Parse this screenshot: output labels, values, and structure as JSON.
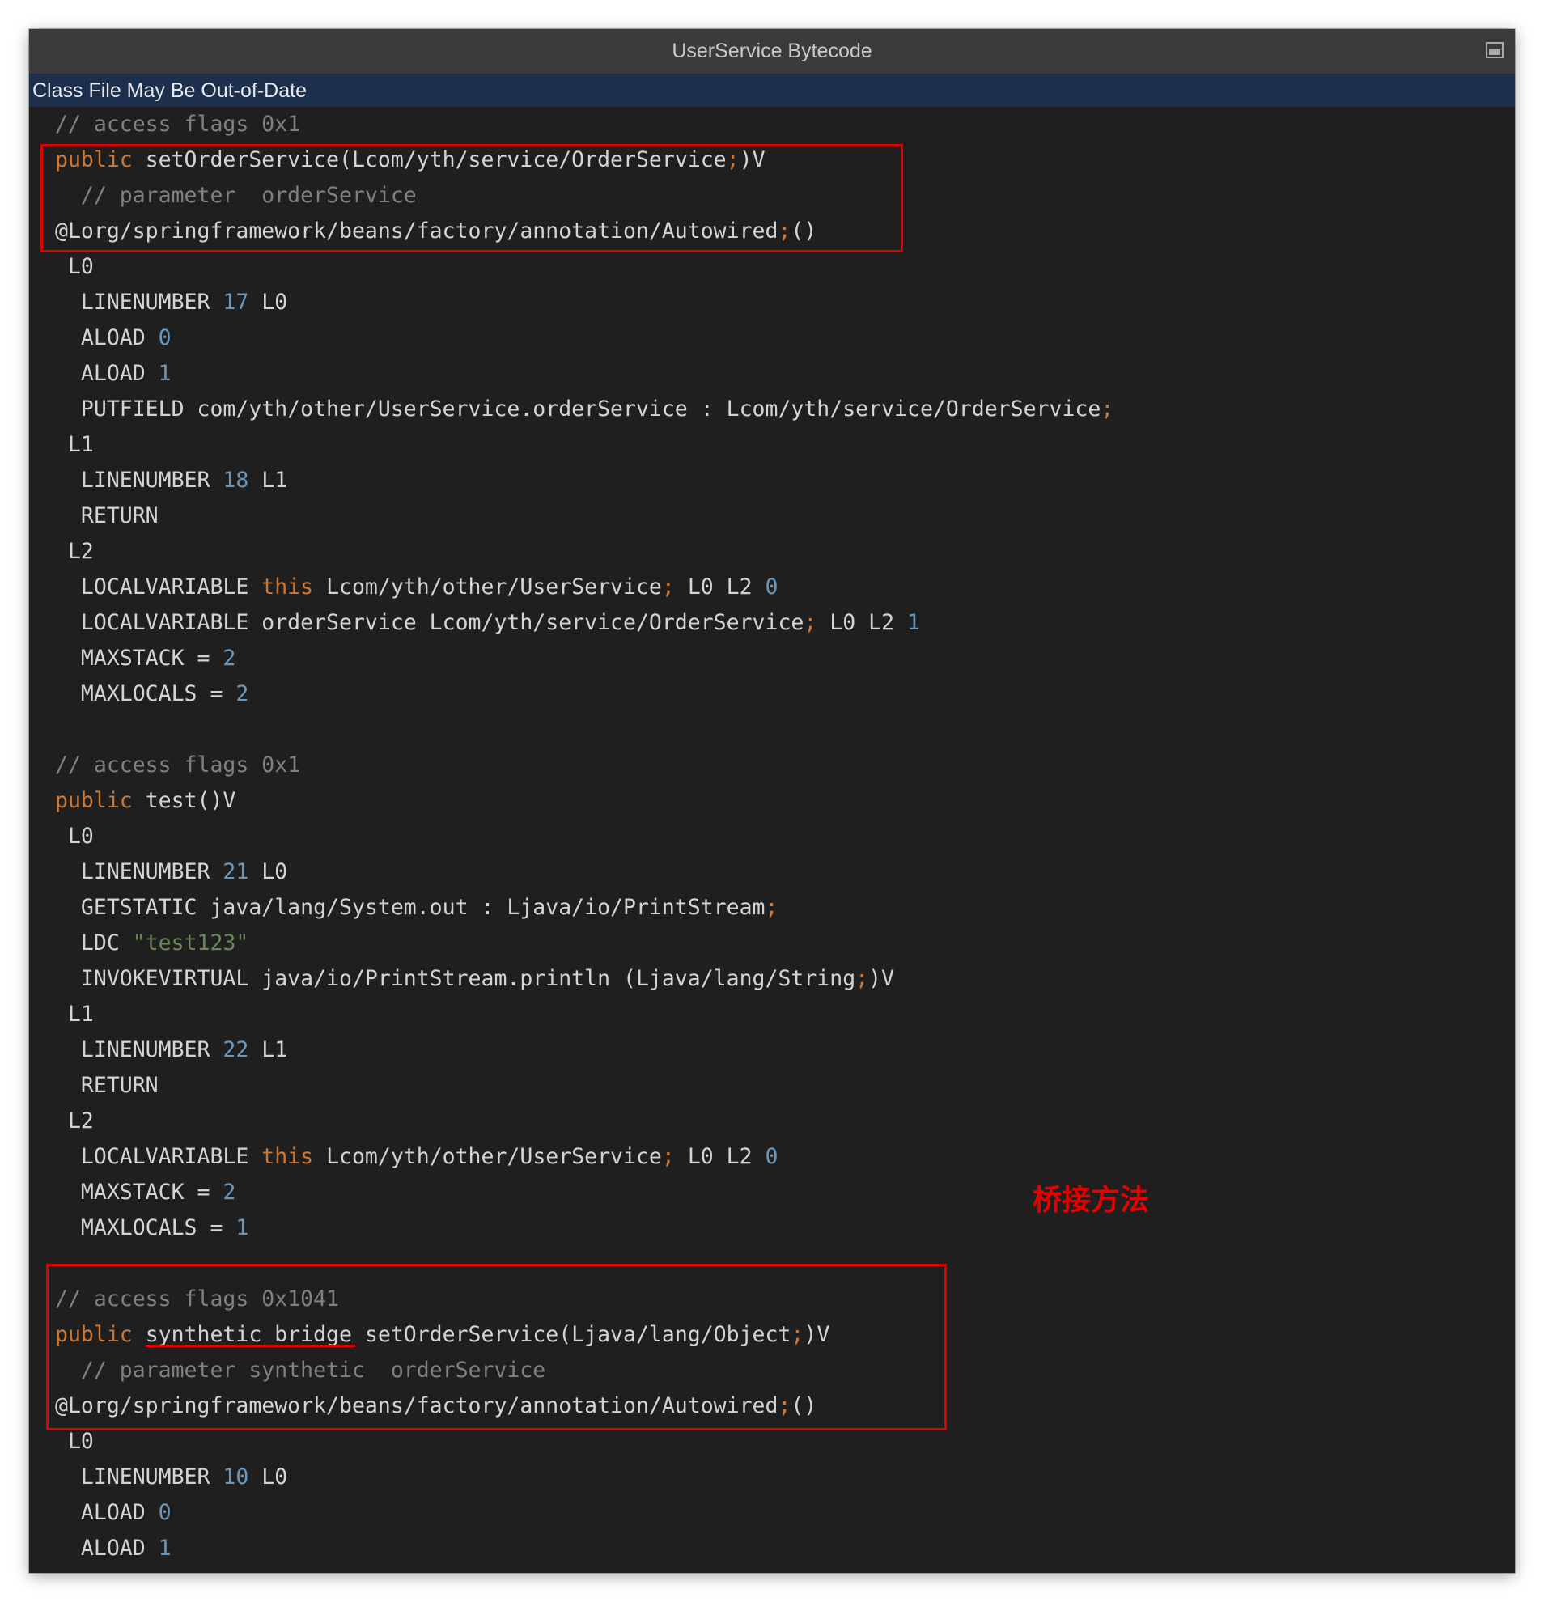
{
  "window": {
    "title": "UserService Bytecode",
    "banner": "Class File May Be Out-of-Date",
    "controls": {
      "restore_icon": "restore-window-icon"
    }
  },
  "annotation": {
    "label": "桥接方法",
    "color": "#e60000"
  },
  "colors": {
    "background": "#1f1f1f",
    "keyword": "#cc7832",
    "number": "#6897bb",
    "string": "#6a8759",
    "comment": "#808080",
    "highlight": "#e00000"
  },
  "code_lines": [
    [
      {
        "t": "// access flags 0x1",
        "c": "cmt"
      }
    ],
    [
      {
        "t": "public",
        "c": "kw"
      },
      {
        "t": " setOrderService(Lcom/yth/service/OrderService"
      },
      {
        "t": ";",
        "c": "semi"
      },
      {
        "t": ")V"
      }
    ],
    [
      {
        "t": "  // parameter  orderService",
        "c": "cmt"
      }
    ],
    [
      {
        "t": "@Lorg/springframework/beans/factory/annotation/Autowired"
      },
      {
        "t": ";",
        "c": "semi"
      },
      {
        "t": "()"
      }
    ],
    [
      {
        "t": " L0"
      }
    ],
    [
      {
        "t": "  LINENUMBER "
      },
      {
        "t": "17",
        "c": "num"
      },
      {
        "t": " L0"
      }
    ],
    [
      {
        "t": "  ALOAD "
      },
      {
        "t": "0",
        "c": "num"
      }
    ],
    [
      {
        "t": "  ALOAD "
      },
      {
        "t": "1",
        "c": "num"
      }
    ],
    [
      {
        "t": "  PUTFIELD com/yth/other/UserService.orderService : Lcom/yth/service/OrderService"
      },
      {
        "t": ";",
        "c": "semi"
      }
    ],
    [
      {
        "t": " L1"
      }
    ],
    [
      {
        "t": "  LINENUMBER "
      },
      {
        "t": "18",
        "c": "num"
      },
      {
        "t": " L1"
      }
    ],
    [
      {
        "t": "  RETURN"
      }
    ],
    [
      {
        "t": " L2"
      }
    ],
    [
      {
        "t": "  LOCALVARIABLE "
      },
      {
        "t": "this",
        "c": "kw"
      },
      {
        "t": " Lcom/yth/other/UserService"
      },
      {
        "t": ";",
        "c": "semi"
      },
      {
        "t": " L0 L2 "
      },
      {
        "t": "0",
        "c": "num"
      }
    ],
    [
      {
        "t": "  LOCALVARIABLE orderService Lcom/yth/service/OrderService"
      },
      {
        "t": ";",
        "c": "semi"
      },
      {
        "t": " L0 L2 "
      },
      {
        "t": "1",
        "c": "num"
      }
    ],
    [
      {
        "t": "  MAXSTACK = "
      },
      {
        "t": "2",
        "c": "num"
      }
    ],
    [
      {
        "t": "  MAXLOCALS = "
      },
      {
        "t": "2",
        "c": "num"
      }
    ],
    [
      {
        "t": ""
      }
    ],
    [
      {
        "t": "// access flags 0x1",
        "c": "cmt"
      }
    ],
    [
      {
        "t": "public",
        "c": "kw"
      },
      {
        "t": " test()V"
      }
    ],
    [
      {
        "t": " L0"
      }
    ],
    [
      {
        "t": "  LINENUMBER "
      },
      {
        "t": "21",
        "c": "num"
      },
      {
        "t": " L0"
      }
    ],
    [
      {
        "t": "  GETSTATIC java/lang/System.out : Ljava/io/PrintStream"
      },
      {
        "t": ";",
        "c": "semi"
      }
    ],
    [
      {
        "t": "  LDC "
      },
      {
        "t": "\"test123\"",
        "c": "str"
      }
    ],
    [
      {
        "t": "  INVOKEVIRTUAL java/io/PrintStream.println (Ljava/lang/String"
      },
      {
        "t": ";",
        "c": "semi"
      },
      {
        "t": ")V"
      }
    ],
    [
      {
        "t": " L1"
      }
    ],
    [
      {
        "t": "  LINENUMBER "
      },
      {
        "t": "22",
        "c": "num"
      },
      {
        "t": " L1"
      }
    ],
    [
      {
        "t": "  RETURN"
      }
    ],
    [
      {
        "t": " L2"
      }
    ],
    [
      {
        "t": "  LOCALVARIABLE "
      },
      {
        "t": "this",
        "c": "kw"
      },
      {
        "t": " Lcom/yth/other/UserService"
      },
      {
        "t": ";",
        "c": "semi"
      },
      {
        "t": " L0 L2 "
      },
      {
        "t": "0",
        "c": "num"
      }
    ],
    [
      {
        "t": "  MAXSTACK = "
      },
      {
        "t": "2",
        "c": "num"
      }
    ],
    [
      {
        "t": "  MAXLOCALS = "
      },
      {
        "t": "1",
        "c": "num"
      }
    ],
    [
      {
        "t": ""
      }
    ],
    [
      {
        "t": "// access flags 0x1041",
        "c": "cmt"
      }
    ],
    [
      {
        "t": "public",
        "c": "kw"
      },
      {
        "t": " synthetic bridge setOrderService(Ljava/lang/Object"
      },
      {
        "t": ";",
        "c": "semi"
      },
      {
        "t": ")V"
      }
    ],
    [
      {
        "t": "  // parameter synthetic  orderService",
        "c": "cmt"
      }
    ],
    [
      {
        "t": "@Lorg/springframework/beans/factory/annotation/Autowired"
      },
      {
        "t": ";",
        "c": "semi"
      },
      {
        "t": "()"
      }
    ],
    [
      {
        "t": " L0"
      }
    ],
    [
      {
        "t": "  LINENUMBER "
      },
      {
        "t": "10",
        "c": "num"
      },
      {
        "t": " L0"
      }
    ],
    [
      {
        "t": "  ALOAD "
      },
      {
        "t": "0",
        "c": "num"
      }
    ],
    [
      {
        "t": "  ALOAD "
      },
      {
        "t": "1",
        "c": "num"
      }
    ]
  ]
}
